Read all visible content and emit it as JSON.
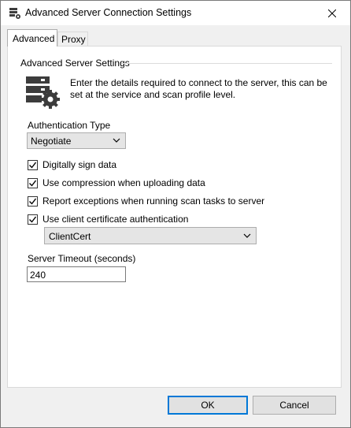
{
  "window": {
    "title": "Advanced Server Connection Settings"
  },
  "tabs": [
    {
      "label": "Advanced",
      "selected": true
    },
    {
      "label": "Proxy",
      "selected": false
    }
  ],
  "group": {
    "label": "Advanced Server Settings"
  },
  "description": "Enter the details required to connect to the server, this can be set at the service and scan profile level.",
  "auth": {
    "label": "Authentication Type",
    "value": "Negotiate"
  },
  "options": [
    {
      "label": "Digitally sign data",
      "checked": true
    },
    {
      "label": "Use compression when uploading data",
      "checked": true
    },
    {
      "label": "Report exceptions when running scan tasks to server",
      "checked": true
    },
    {
      "label": "Use client certificate authentication",
      "checked": true
    }
  ],
  "certificate": {
    "value": "ClientCert"
  },
  "timeout": {
    "label": "Server Timeout (seconds)",
    "value": "240"
  },
  "buttons": {
    "ok": "OK",
    "cancel": "Cancel"
  },
  "colors": {
    "accent": "#0078d7",
    "icon": "#3c3c3c"
  }
}
